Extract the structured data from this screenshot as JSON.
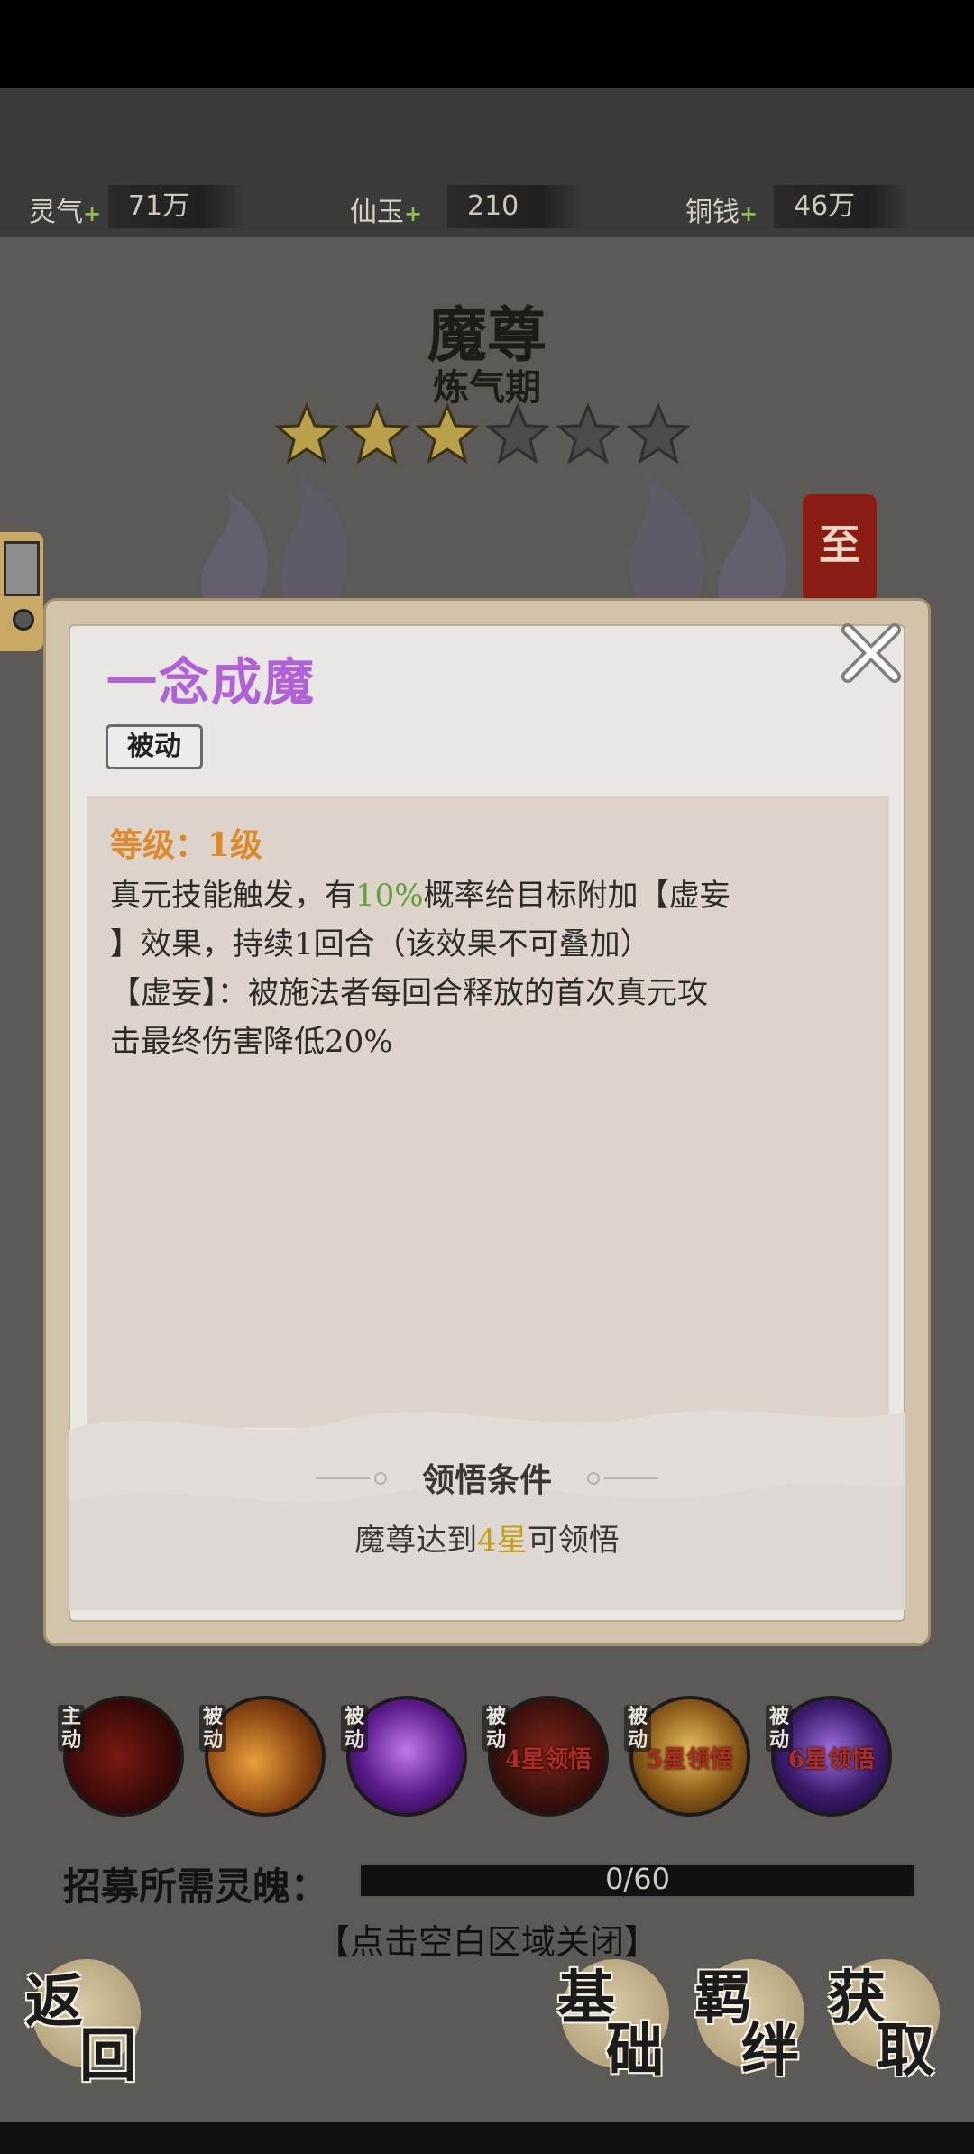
{
  "resources": [
    {
      "label": "灵气",
      "value": "71万"
    },
    {
      "label": "仙玉",
      "value": "210"
    },
    {
      "label": "铜钱",
      "value": "46万"
    }
  ],
  "hero": {
    "name": "魔尊",
    "realm": "炼气期",
    "stars_filled": 3,
    "stars_total": 6,
    "banner_char": "至"
  },
  "dialog": {
    "skill_name": "一念成魔",
    "skill_type": "被动",
    "level": "等级：1级",
    "desc_line1_a": "真元技能触发，有",
    "desc_line1_pct": "10%",
    "desc_line1_b": "概率给目标附加【虚妄",
    "desc_line2": "】效果，持续1回合（该效果不可叠加）",
    "desc_line3": "【虚妄】：被施法者每回合释放的首次真元攻",
    "desc_line4": "击最终伤害降低20%",
    "condition_title": "领悟条件",
    "condition_a": "魔尊达到",
    "condition_star": "4星",
    "condition_b": "可领悟",
    "accent_color": "#b061d8"
  },
  "skills": [
    {
      "tag": "主动",
      "lock": ""
    },
    {
      "tag": "被动",
      "lock": ""
    },
    {
      "tag": "被动",
      "lock": ""
    },
    {
      "tag": "被动",
      "lock": "4星领悟"
    },
    {
      "tag": "被动",
      "lock": "5星领悟"
    },
    {
      "tag": "被动",
      "lock": "6星领悟"
    }
  ],
  "recruit": {
    "label": "招募所需灵魄：",
    "progress": "0/60",
    "progress_fraction": 0
  },
  "close_hint": "【点击空白区域关闭】",
  "buttons": {
    "back": [
      "返",
      "回"
    ],
    "base": [
      "基",
      "础"
    ],
    "bond": [
      "羁",
      "绊"
    ],
    "obtain": [
      "获",
      "取"
    ]
  }
}
